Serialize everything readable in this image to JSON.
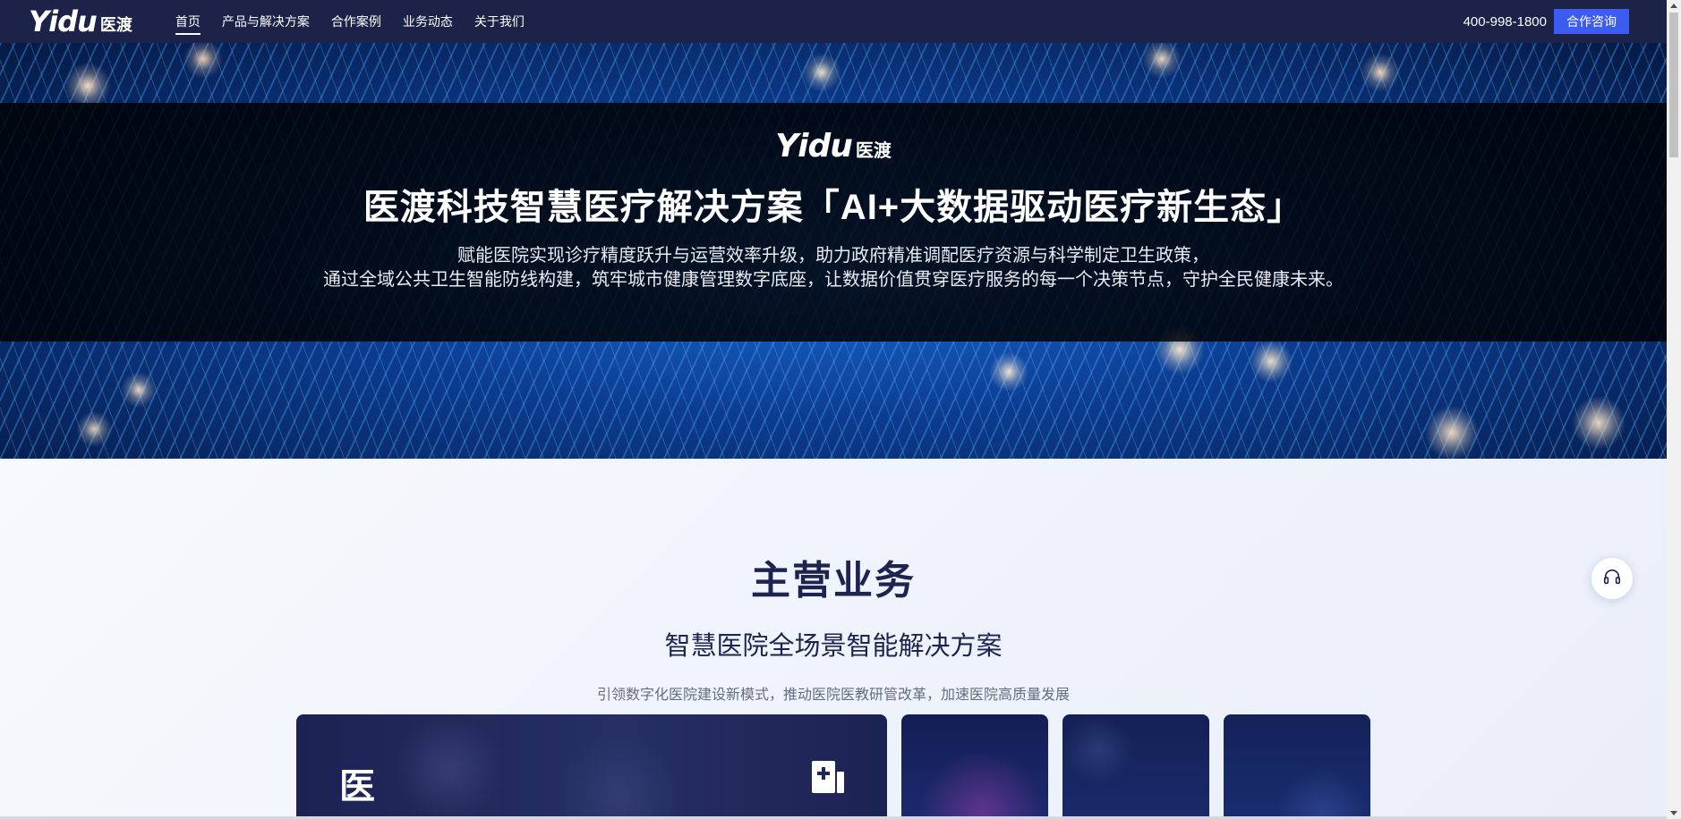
{
  "header": {
    "logo": {
      "latin": "Yidu",
      "cjk": "医渡"
    },
    "nav": [
      {
        "label": "首页",
        "active": true
      },
      {
        "label": "产品与解决方案",
        "active": false
      },
      {
        "label": "合作案例",
        "active": false
      },
      {
        "label": "业务动态",
        "active": false
      },
      {
        "label": "关于我们",
        "active": false
      }
    ],
    "phone": "400-998-1800",
    "consult_label": "合作咨询"
  },
  "hero": {
    "logo": {
      "latin": "Yidu",
      "cjk": "医渡"
    },
    "title": "医渡科技智慧医疗解决方案「AI+大数据驱动医疗新生态」",
    "desc_line1": "赋能医院实现诊疗精度跃升与运营效率升级，助力政府精准调配医疗资源与科学制定卫生政策，",
    "desc_line2": "通过全域公共卫生智能防线构建，筑牢城市健康管理数字底座，让数据价值贯穿医疗服务的每一个决策节点，守护全民健康未来。"
  },
  "business": {
    "title": "主营业务",
    "subtitle": "智慧医院全场景智能解决方案",
    "desc": "引领数字化医院建设新模式，推动医院医教研管改革，加速医院高质量发展",
    "cards": [
      {
        "title": "医",
        "icon": "hospital-plus-icon"
      },
      {
        "title": ""
      },
      {
        "title": ""
      },
      {
        "title": ""
      }
    ]
  },
  "colors": {
    "nav_bg": "#1d2248",
    "accent": "#3b5bf2",
    "heading": "#1e2450"
  },
  "floating": {
    "icon": "headset-icon"
  }
}
